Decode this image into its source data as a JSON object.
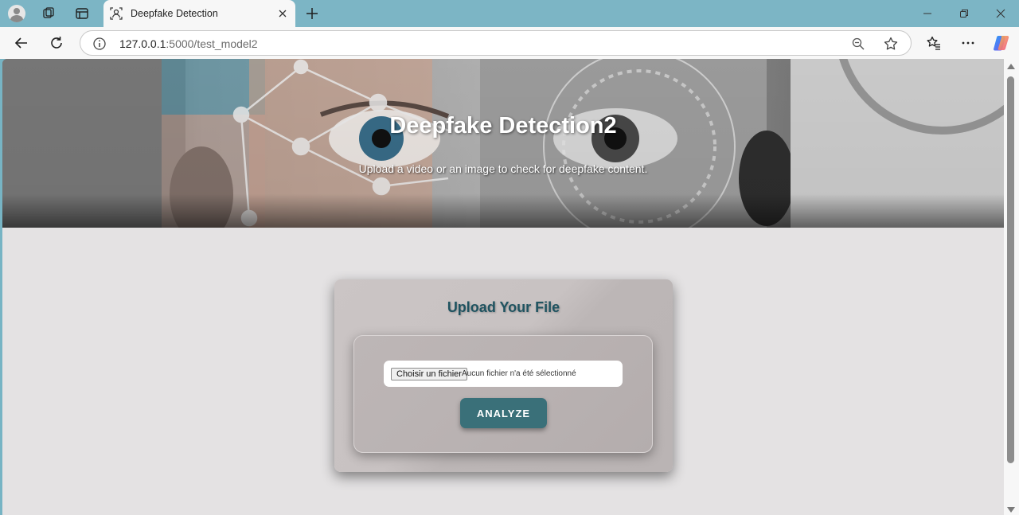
{
  "browser": {
    "tab": {
      "title": "Deepfake Detection",
      "favicon": "face-scan-icon"
    },
    "address": {
      "host": "127.0.0.1",
      "rest": ":5000/test_model2"
    },
    "colors": {
      "tabstrip": "#7cb5c5",
      "toolbar": "#f7f7f7"
    }
  },
  "page": {
    "hero": {
      "title": "Deepfake Detection2",
      "subtitle": "Upload a video or an image to check for deepfake content."
    },
    "upload": {
      "heading": "Upload Your File",
      "choose_label": "Choisir un fichier",
      "no_file_text": "Aucun fichier n'a été sélectionné",
      "analyze_label": "ANALYZE"
    },
    "colors": {
      "background": "#e4e2e3",
      "accent": "#3a7079",
      "heading": "#1f5360"
    }
  }
}
